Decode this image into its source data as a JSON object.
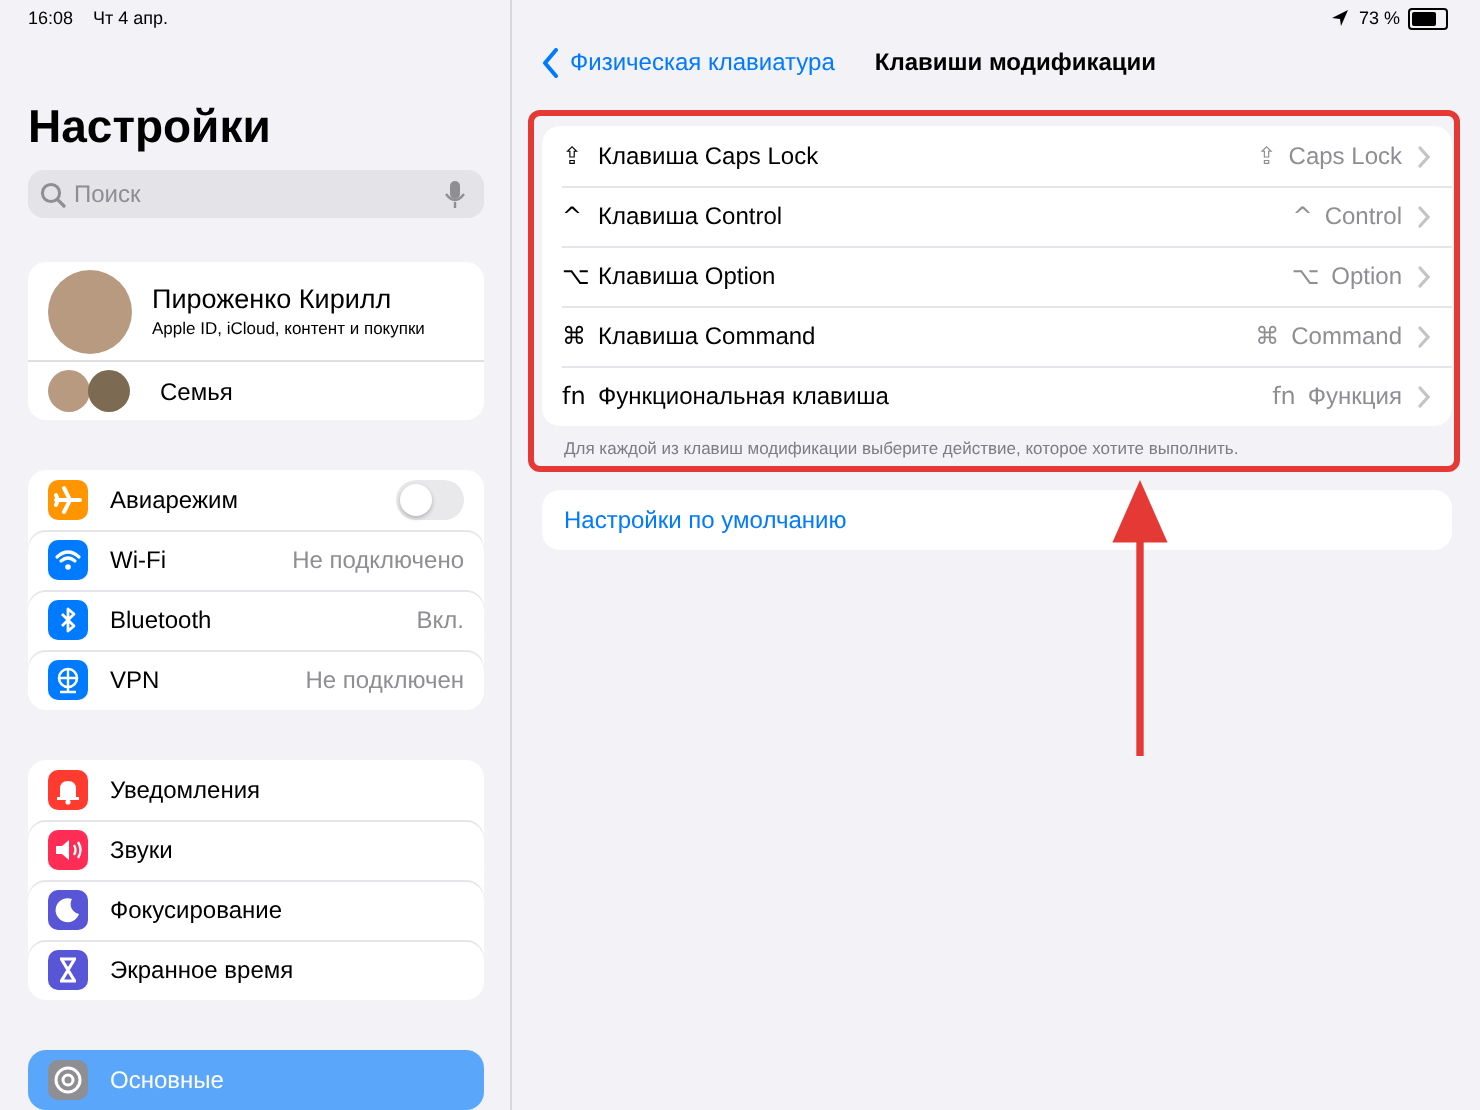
{
  "status_bar": {
    "time": "16:08",
    "date": "Чт 4 апр.",
    "battery_text": "73 %"
  },
  "sidebar": {
    "title": "Настройки",
    "search": {
      "placeholder": "Поиск"
    },
    "profile": {
      "name": "Пироженко Кирилл",
      "subtitle": "Apple ID, iCloud, контент и покупки",
      "family": "Семья"
    },
    "groups": [
      {
        "items": [
          {
            "label": "Авиарежим",
            "kind": "toggle",
            "on": false,
            "color": "#ff9500",
            "selected": false
          },
          {
            "label": "Wi-Fi",
            "kind": "value",
            "value": "Не подключено",
            "color": "#007aff",
            "selected": false
          },
          {
            "label": "Bluetooth",
            "kind": "value",
            "value": "Вкл.",
            "color": "#007aff",
            "selected": false
          },
          {
            "label": "VPN",
            "kind": "value",
            "value": "Не подключен",
            "color": "#007aff",
            "selected": false
          }
        ]
      },
      {
        "items": [
          {
            "label": "Уведомления",
            "kind": "plain",
            "color": "#ff3b30",
            "selected": false
          },
          {
            "label": "Звуки",
            "kind": "plain",
            "color": "#ff2d55",
            "selected": false
          },
          {
            "label": "Фокусирование",
            "kind": "plain",
            "color": "#5856d6",
            "selected": false
          },
          {
            "label": "Экранное время",
            "kind": "plain",
            "color": "#5856d6",
            "selected": false
          }
        ]
      },
      {
        "items": [
          {
            "label": "Основные",
            "kind": "plain",
            "color": "#8e8e93",
            "selected": true
          }
        ]
      }
    ]
  },
  "detail": {
    "back": "Физическая клавиатура",
    "title": "Клавиши модификации",
    "keys": [
      {
        "symbol": "⇪",
        "label": "Клавиша Caps Lock",
        "value_symbol": "⇪",
        "value": "Caps Lock"
      },
      {
        "symbol": "^",
        "label": "Клавиша Control",
        "value_symbol": "^",
        "value": "Control"
      },
      {
        "symbol": "⌥",
        "label": "Клавиша Option",
        "value_symbol": "⌥",
        "value": "Option"
      },
      {
        "symbol": "⌘",
        "label": "Клавиша Command",
        "value_symbol": "⌘",
        "value": "Command"
      },
      {
        "symbol": "fn",
        "label": "Функциональная клавиша",
        "value_symbol": "fn",
        "value": "Функция"
      }
    ],
    "footnote": "Для каждой из клавиш модификации выберите действие, которое хотите выполнить.",
    "reset": "Настройки по умолчанию"
  }
}
